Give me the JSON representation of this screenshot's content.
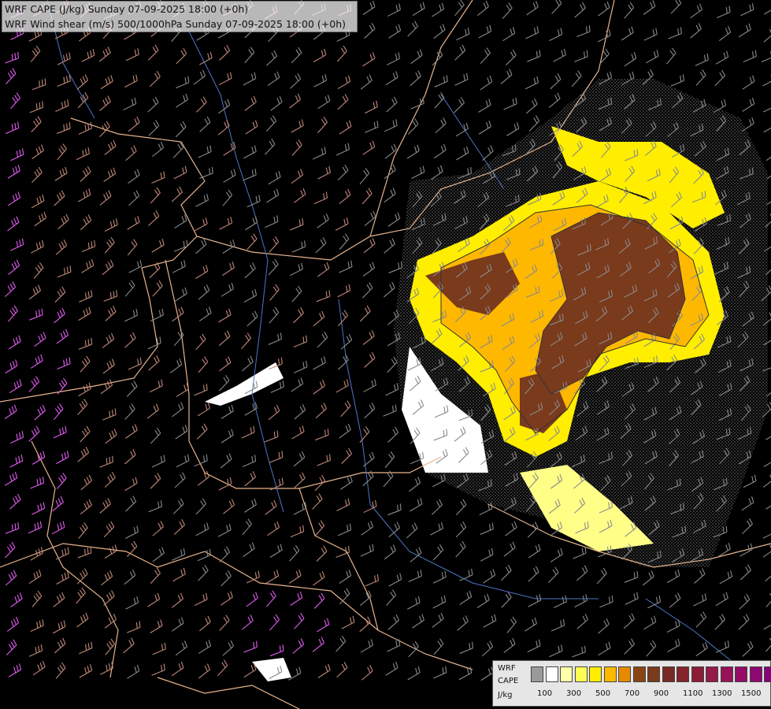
{
  "header": {
    "line1": "WRF CAPE (J/kg) Sunday 07-09-2025 18:00 (+0h)",
    "line2": "WRF Wind shear (m/s) 500/1000hPa Sunday 07-09-2025 18:00 (+0h)"
  },
  "legend": {
    "label_model": "WRF",
    "label_field": "CAPE",
    "label_unit": "J/kg",
    "colors": [
      "#9a9a9a",
      "#ffffff",
      "#ffffaa",
      "#ffff55",
      "#ffee00",
      "#ffb800",
      "#e78a00",
      "#8b4513",
      "#7a3a1c",
      "#7a2a24",
      "#84242c",
      "#8c1c38",
      "#941a48",
      "#981258",
      "#960c66",
      "#8e0870",
      "#860478"
    ],
    "ticks": [
      "100",
      "300",
      "500",
      "700",
      "900",
      "1100",
      "1300",
      "1500"
    ]
  },
  "colors": {
    "background": "#000000",
    "borders": "#e8b48c",
    "rivers": "#4f74c8",
    "barb_low": "#8a8a8a",
    "barb_mid": "#c08878",
    "barb_high": "#e05cf0"
  }
}
